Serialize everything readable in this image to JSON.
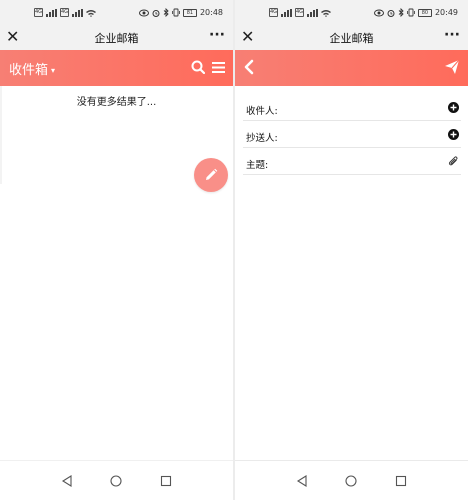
{
  "left": {
    "status": {
      "time": "20:48",
      "battery": "81",
      "sim1": "4G",
      "sim2": "4G"
    },
    "header": {
      "title": "企业邮箱"
    },
    "appbar": {
      "folder": "收件箱"
    },
    "list": {
      "end_message": "没有更多结果了..."
    },
    "icons": {
      "close": "close-icon",
      "more": "more-icon",
      "search": "search-icon",
      "menu": "menu-icon",
      "compose": "pencil-icon"
    }
  },
  "right": {
    "status": {
      "time": "20:49",
      "battery": "80",
      "sim1": "4G",
      "sim2": "4G"
    },
    "header": {
      "title": "企业邮箱"
    },
    "form": {
      "to_label": "收件人:",
      "cc_label": "抄送人:",
      "subject_label": "主题:"
    },
    "icons": {
      "close": "close-icon",
      "more": "more-icon",
      "back": "back-icon",
      "send": "send-icon",
      "add": "plus-circle-icon",
      "attach": "paperclip-icon"
    }
  },
  "colors": {
    "accent_start": "#f77f74",
    "accent_end": "#ff6b5b",
    "fab": "#f98f88"
  }
}
